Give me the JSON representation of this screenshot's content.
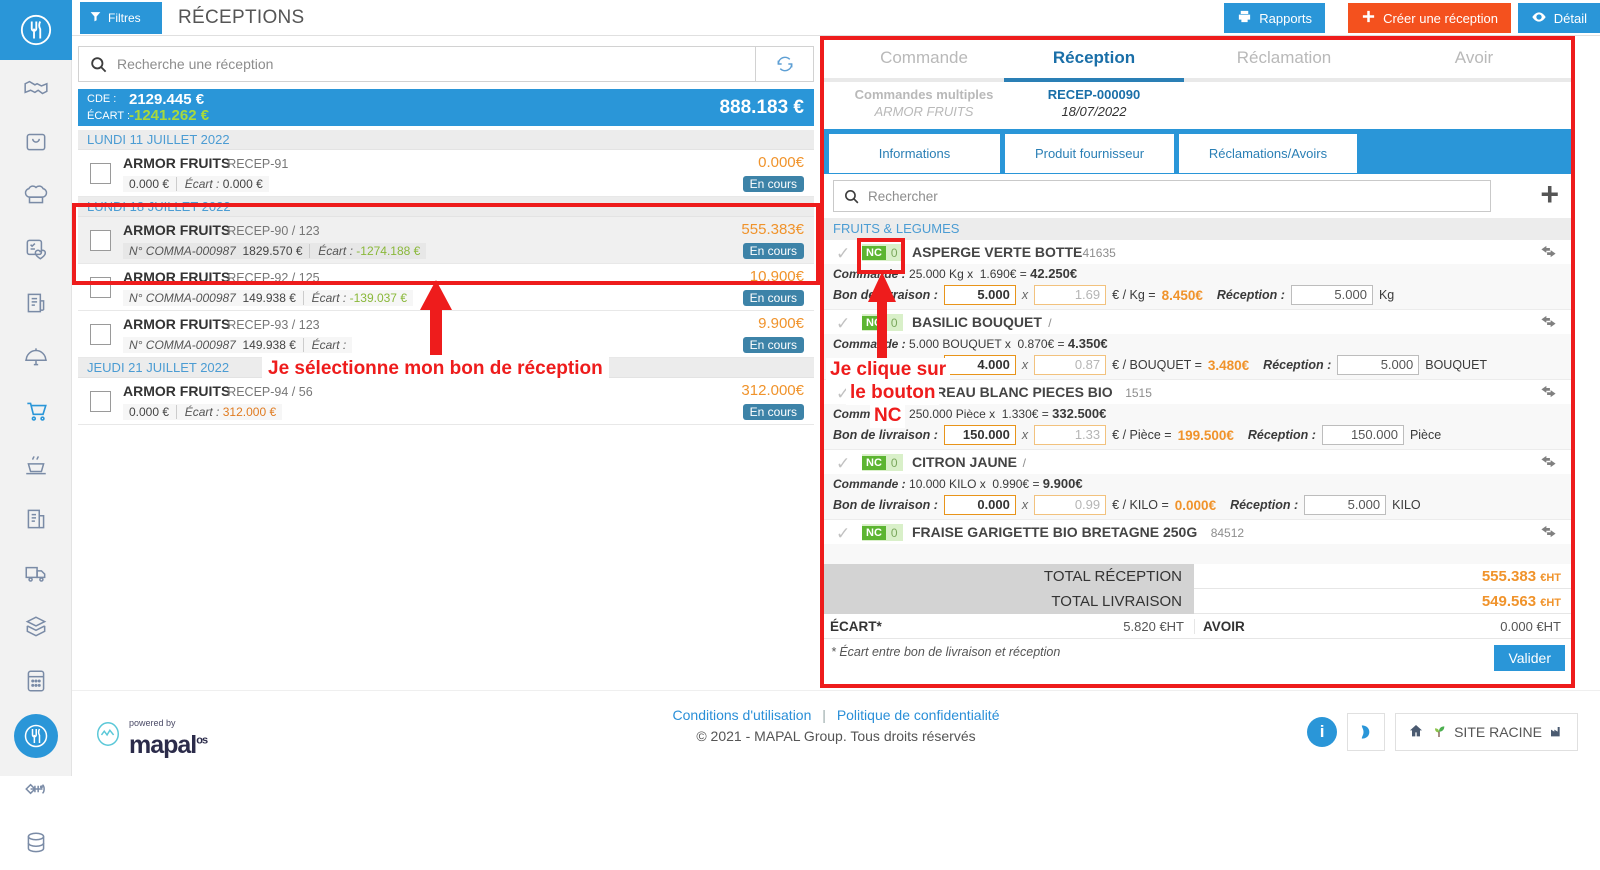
{
  "topbar": {
    "filters_label": "Filtres",
    "page_title": "RÉCEPTIONS",
    "rapports_label": "Rapports",
    "creer_label": "Créer une réception",
    "detail_label": "Détail"
  },
  "search": {
    "placeholder": "Recherche une réception"
  },
  "summary": {
    "cde_label": "CDE :",
    "cde_value": "2129.445 €",
    "ecart_label": "ÉCART :",
    "ecart_value": "-1241.262 €",
    "total": "888.183 €"
  },
  "groups": [
    {
      "date": "LUNDI 11 JUILLET 2022",
      "rows": [
        {
          "supplier": "ARMOR FRUITS",
          "code": "RECEP-91",
          "line1": "0.000 €",
          "ecart_label": "Écart :",
          "ecart": "0.000 €",
          "ecart_sign": "zero",
          "amount": "0.000€",
          "status": "En cours",
          "order_no": ""
        }
      ]
    },
    {
      "date": "LUNDI 18 JUILLET 2022",
      "rows": [
        {
          "supplier": "ARMOR FRUITS",
          "code": "RECEP-90 / 123",
          "order_no": "N° COMMA-000987",
          "line1": "1829.570 €",
          "ecart_label": "Écart :",
          "ecart": "-1274.188 €",
          "ecart_sign": "neg",
          "amount": "555.383€",
          "status": "En cours"
        },
        {
          "supplier": "ARMOR FRUITS",
          "code": "RECEP-92 / 125",
          "order_no": "N° COMMA-000987",
          "line1": "149.938 €",
          "ecart_label": "Écart :",
          "ecart": "-139.037 €",
          "ecart_sign": "neg",
          "amount": "10.900€",
          "status": "En cours"
        },
        {
          "supplier": "ARMOR FRUITS",
          "code": "RECEP-93 / 123",
          "order_no": "N° COMMA-000987",
          "line1": "149.938 €",
          "ecart_label": "Écart :",
          "ecart": "",
          "ecart_sign": "neg",
          "amount": "9.900€",
          "status": "En cours"
        }
      ]
    },
    {
      "date": "JEUDI 21 JUILLET 2022",
      "rows": [
        {
          "supplier": "ARMOR FRUITS",
          "code": "RECEP-94 / 56",
          "order_no": "",
          "line1": "0.000 €",
          "ecart_label": "Écart :",
          "ecart": "312.000 €",
          "ecart_sign": "pos",
          "amount": "312.000€",
          "status": "En cours"
        }
      ]
    }
  ],
  "right": {
    "tabs": [
      {
        "label": "Commande",
        "selected": false
      },
      {
        "label": "Réception",
        "selected": true
      },
      {
        "label": "Réclamation",
        "selected": false
      },
      {
        "label": "Avoir",
        "selected": false
      }
    ],
    "sub_left_a": "Commandes multiples",
    "sub_left_b": "ARMOR FRUITS",
    "sub_mid_a": "RECEP-000090",
    "sub_mid_b": "18/07/2022",
    "subtabs": [
      {
        "label": "Informations"
      },
      {
        "label": "Produit fournisseur"
      },
      {
        "label": "Réclamations/Avoirs"
      }
    ],
    "search_placeholder": "Rechercher",
    "add_icon": "plus-icon",
    "category": "FRUITS & LEGUMES",
    "products": [
      {
        "nc_tag": "NC",
        "nc_count": "0",
        "name": "ASPERGE VERTE BOTTE",
        "ref": "41635",
        "cmd_label": "Commande :",
        "cmd_qty": "25.000",
        "cmd_unit": "Kg",
        "cmd_x": "x",
        "cmd_price": "1.690€",
        "cmd_eq": "=",
        "cmd_total": "42.250€",
        "bl_label": "Bon de livraison :",
        "bl_qty": "5.000",
        "bl_price": "1.69",
        "bl_per": "€ / Kg =",
        "bl_total": "8.450€",
        "rec_label": "Réception :",
        "rec_qty": "5.000",
        "rec_unit": "Kg"
      },
      {
        "nc_tag": "NC",
        "nc_count": "0",
        "name": "BASILIC BOUQUET",
        "ref": "/",
        "cmd_label": "Commande :",
        "cmd_qty": "5.000",
        "cmd_unit": "BOUQUET",
        "cmd_x": "x",
        "cmd_price": "0.870€",
        "cmd_eq": "=",
        "cmd_total": "4.350€",
        "bl_label": "Bon de livraison :",
        "bl_qty": "4.000",
        "bl_price": "0.87",
        "bl_per": "€ / BOUQUET =",
        "bl_total": "3.480€",
        "rec_label": "Réception :",
        "rec_qty": "5.000",
        "rec_unit": "BOUQUET"
      },
      {
        "nc_tag": "NC",
        "nc_count": "0",
        "name": "POIREAU BLANC PIECES BIO",
        "ref": "1515",
        "cmd_label": "Commande :",
        "cmd_qty": "250.000",
        "cmd_unit": "Pièce",
        "cmd_x": "x",
        "cmd_price": "1.330€",
        "cmd_eq": "=",
        "cmd_total": "332.500€",
        "bl_label": "Bon de livraison :",
        "bl_qty": "150.000",
        "bl_price": "1.33",
        "bl_per": "€ / Pièce =",
        "bl_total": "199.500€",
        "rec_label": "Réception :",
        "rec_qty": "150.000",
        "rec_unit": "Pièce"
      },
      {
        "nc_tag": "NC",
        "nc_count": "0",
        "name": "CITRON JAUNE",
        "ref": "/",
        "cmd_label": "Commande :",
        "cmd_qty": "10.000",
        "cmd_unit": "KILO",
        "cmd_x": "x",
        "cmd_price": "0.990€",
        "cmd_eq": "=",
        "cmd_total": "9.900€",
        "bl_label": "Bon de livraison :",
        "bl_qty": "0.000",
        "bl_price": "0.99",
        "bl_per": "€ / KILO =",
        "bl_total": "0.000€",
        "rec_label": "Réception :",
        "rec_qty": "5.000",
        "rec_unit": "KILO"
      },
      {
        "nc_tag": "NC",
        "nc_count": "0",
        "name": "FRAISE GARIGETTE BIO BRETAGNE 250G",
        "ref": "84512",
        "cmd_label": "Commande :",
        "cmd_qty": "",
        "cmd_unit": "",
        "cmd_x": "",
        "cmd_price": "",
        "cmd_eq": "",
        "cmd_total": "",
        "bl_label": "",
        "bl_qty": "",
        "bl_price": "",
        "bl_per": "",
        "bl_total": "",
        "rec_label": "",
        "rec_qty": "",
        "rec_unit": ""
      }
    ],
    "totals": {
      "reception_label": "TOTAL RÉCEPTION",
      "reception_value": "555.383",
      "reception_unit": "€HT",
      "livraison_label": "TOTAL LIVRAISON",
      "livraison_value": "549.563",
      "livraison_unit": "€HT",
      "ecart_label": "ÉCART*",
      "ecart_value": "5.820 €HT",
      "avoir_label": "AVOIR",
      "avoir_value": "0.000 €HT",
      "note": "* Écart entre bon de livraison et réception",
      "valider_label": "Valider"
    }
  },
  "annotations": [
    {
      "text": "Je sélectionne mon bon de réception"
    },
    {
      "text": "Je clique sur"
    },
    {
      "text": "le bouton"
    },
    {
      "text": "NC"
    }
  ],
  "footer": {
    "powered_by": "powered by",
    "brand": "mapal",
    "brand_suffix": "os",
    "terms": "Conditions d'utilisation",
    "privacy": "Politique de confidentialité",
    "copyright": "© 2021 - MAPAL Group. Tous droits réservés",
    "site_label": "SITE RACINE"
  },
  "colors": {
    "accent": "#2a96d8",
    "orange": "#f0932b",
    "red": "#ee1c1c",
    "green": "#5cb531"
  }
}
